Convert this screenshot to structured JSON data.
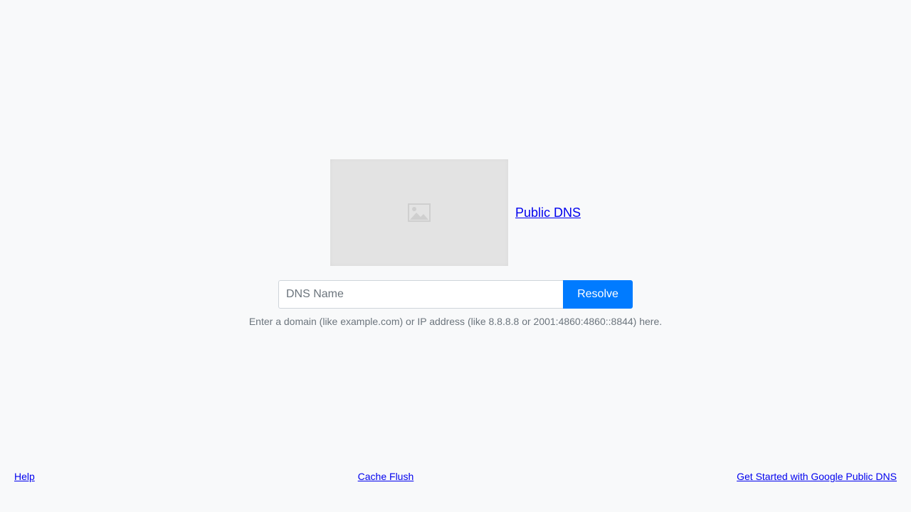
{
  "header": {
    "logo_icon": "image-placeholder-icon",
    "brand_link": "Public DNS"
  },
  "search": {
    "placeholder": "DNS Name",
    "value": "",
    "button_label": "Resolve",
    "hint": "Enter a domain (like example.com) or IP address (like 8.8.8.8 or 2001:4860:4860::8844) here.",
    "button_color": "#007bff"
  },
  "footer": {
    "links": [
      {
        "label": "Help"
      },
      {
        "label": "Cache Flush"
      },
      {
        "label": "Get Started with Google Public DNS"
      }
    ]
  }
}
